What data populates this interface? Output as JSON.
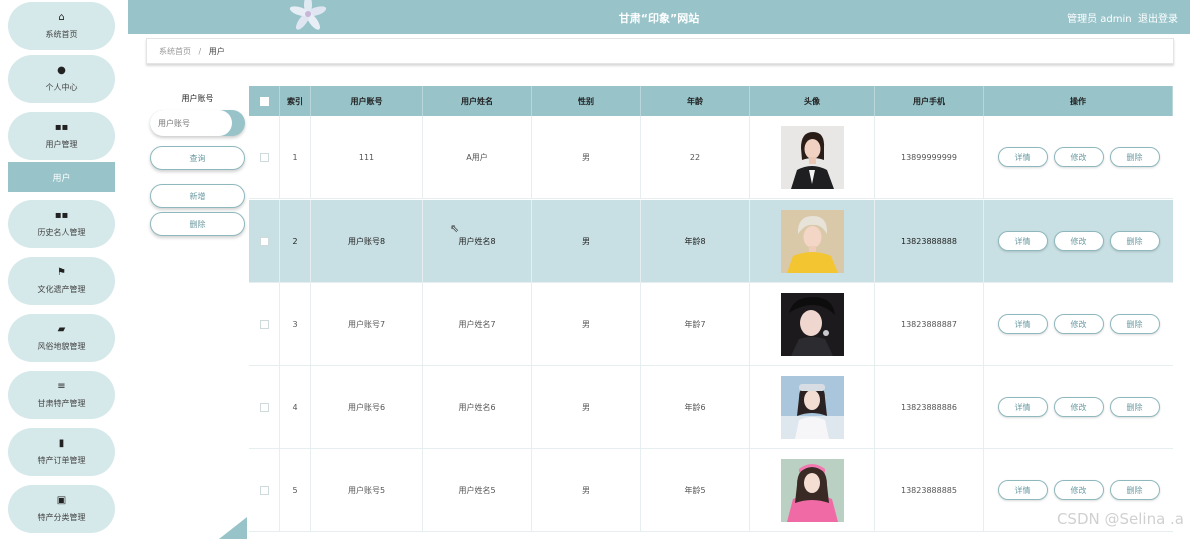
{
  "sidebar": {
    "items": [
      {
        "label": "系统首页",
        "icon": "home-icon",
        "glyph": "⌂"
      },
      {
        "label": "个人中心",
        "icon": "user-icon",
        "glyph": "●"
      },
      {
        "label": "用户管理",
        "icon": "grid-icon",
        "glyph": "▪▪"
      },
      {
        "label": "历史名人管理",
        "icon": "grid-icon",
        "glyph": "▪▪"
      },
      {
        "label": "文化遗产管理",
        "icon": "flag-icon",
        "glyph": "⚑"
      },
      {
        "label": "风俗地貌管理",
        "icon": "briefcase-icon",
        "glyph": "▰"
      },
      {
        "label": "甘肃特产管理",
        "icon": "menu-icon",
        "glyph": "≡"
      },
      {
        "label": "特产订单管理",
        "icon": "book-icon",
        "glyph": "▮"
      },
      {
        "label": "特产分类管理",
        "icon": "chart-icon",
        "glyph": "▣"
      }
    ],
    "active_sub": "用户"
  },
  "header": {
    "title": "甘肃“印象”网站",
    "user": "管理员 admin",
    "logout": "退出登录"
  },
  "breadcrumb": {
    "home": "系统首页",
    "sep": "/",
    "current": "用户"
  },
  "search": {
    "label": "用户账号",
    "placeholder": "用户账号",
    "query_btn": "查询",
    "add_btn": "新增",
    "delete_btn": "删除"
  },
  "table": {
    "columns": [
      "索引",
      "用户账号",
      "用户姓名",
      "性别",
      "年龄",
      "头像",
      "用户手机",
      "操作"
    ],
    "rows": [
      {
        "index": "1",
        "account": "111",
        "name": "A用户",
        "gender": "男",
        "age": "22",
        "phone": "13899999999"
      },
      {
        "index": "2",
        "account": "用户账号8",
        "name": "用户姓名8",
        "gender": "男",
        "age": "年龄8",
        "phone": "13823888888"
      },
      {
        "index": "3",
        "account": "用户账号7",
        "name": "用户姓名7",
        "gender": "男",
        "age": "年龄7",
        "phone": "13823888887"
      },
      {
        "index": "4",
        "account": "用户账号6",
        "name": "用户姓名6",
        "gender": "男",
        "age": "年龄6",
        "phone": "13823888886"
      },
      {
        "index": "5",
        "account": "用户账号5",
        "name": "用户姓名5",
        "gender": "男",
        "age": "年龄5",
        "phone": "13823888885"
      }
    ],
    "actions": {
      "detail": "详情",
      "edit": "修改",
      "delete": "删除"
    }
  },
  "watermark": "CSDN @Selina .a",
  "colors": {
    "accent": "#97c3c9",
    "sidebar_item": "#d5e8ea",
    "highlight_row": "#c8e0e3"
  }
}
